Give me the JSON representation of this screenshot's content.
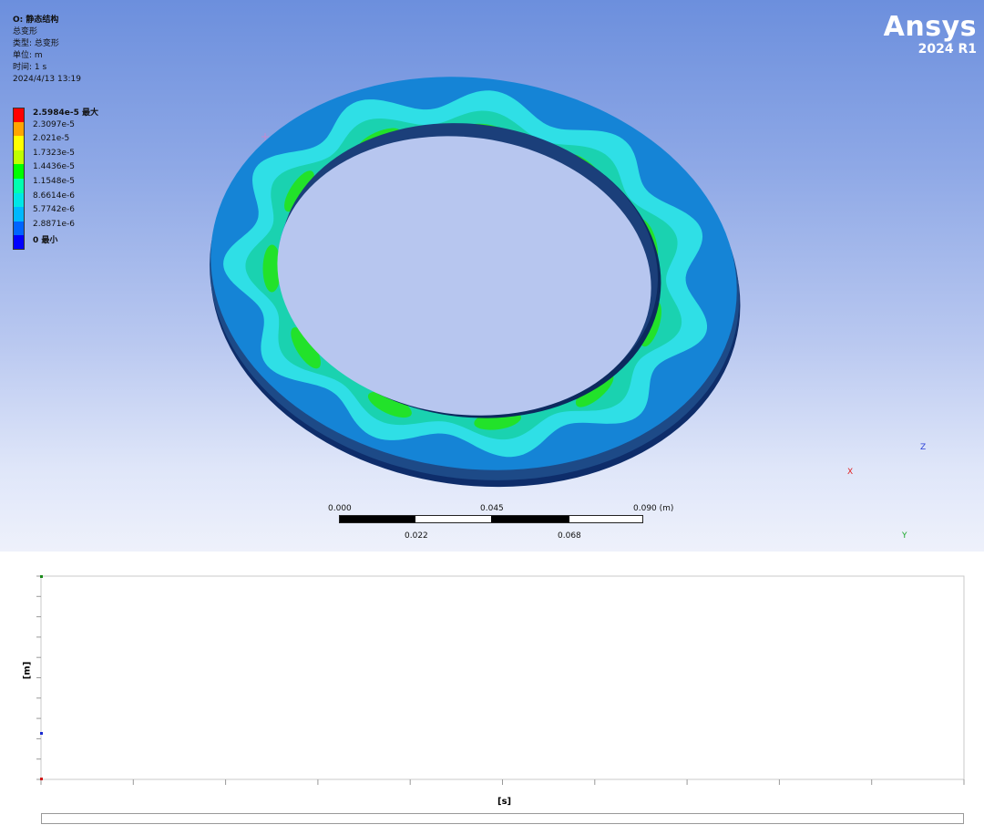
{
  "info": {
    "title": "O: 静态结构",
    "name": "总变形",
    "type": "类型: 总变形",
    "unit": "单位: m",
    "time": "时间: 1 s",
    "date": "2024/4/13 13:19"
  },
  "legend": {
    "labels": [
      "2.5984e-5 最大",
      "2.3097e-5",
      "2.021e-5",
      "1.7323e-5",
      "1.4436e-5",
      "1.1548e-5",
      "8.6614e-6",
      "5.7742e-6",
      "2.8871e-6",
      "0 最小"
    ],
    "colors": [
      "#ff0000",
      "#ffa500",
      "#ffff00",
      "#bfff00",
      "#00ff00",
      "#00ffb0",
      "#00e6e6",
      "#00b8ff",
      "#0064ff",
      "#0000ff"
    ]
  },
  "logo": {
    "brand": "Ansys",
    "version": "2024 R1"
  },
  "scale": {
    "top": [
      "0.000",
      "0.045",
      "0.090 (m)"
    ],
    "bottom": [
      "0.022",
      "0.068"
    ]
  },
  "axes": {
    "x": "X",
    "y": "Y",
    "z": "Z"
  },
  "chart": {
    "ylabel": "[m]",
    "xlabel": "[s]"
  },
  "ring_colors": {
    "band_dark": "#0e2d6a",
    "outer": "#1584d6",
    "mid": "#2fdfe6",
    "inner": "#1ad2b0",
    "hot": "#22e22a"
  }
}
